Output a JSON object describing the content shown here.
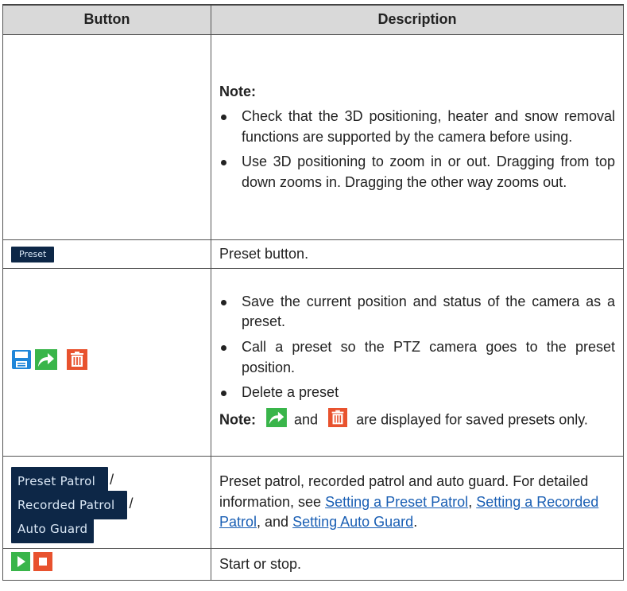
{
  "table": {
    "headers": [
      "Button",
      "Description"
    ],
    "row_note": {
      "note_label": "Note:",
      "bullets": [
        "Check that the 3D positioning, heater and snow removal functions are supported by the camera before using.",
        "Use 3D positioning to zoom in or out. Dragging from top down zooms in. Dragging the other way zooms out."
      ]
    },
    "row_preset": {
      "button_label": "Preset",
      "description": "Preset button."
    },
    "row_preset_actions": {
      "icons": [
        "save-icon",
        "call-preset-arrow-icon",
        "delete-trash-icon"
      ],
      "bullets": [
        "Save the current position and status of the camera as a preset.",
        "Call a preset so the PTZ camera goes to the preset position.",
        "Delete a preset"
      ],
      "note_label": "Note:",
      "note_and": "and",
      "note_tail": "are displayed for saved presets only."
    },
    "row_patrol": {
      "buttons": [
        "Preset Patrol",
        "Recorded Patrol",
        "Auto Guard"
      ],
      "separator": "/",
      "desc_prefix": "Preset patrol, recorded patrol and auto guard. For detailed information, see ",
      "link1": "Setting a Preset Patrol",
      "sep1": ",",
      "link2": "Setting a Recorded Patrol",
      "sep2": ", and ",
      "link3": "Setting Auto Guard",
      "end": "."
    },
    "row_startstop": {
      "icons": [
        "play-icon",
        "stop-icon"
      ],
      "description": "Start or stop."
    }
  },
  "colors": {
    "header_bg": "#d9d9d9",
    "ui_button_bg": "#0d2747",
    "save_icon": "#1f86d9",
    "call_icon": "#39b54a",
    "delete_icon": "#e8522e",
    "link": "#1a5fb4"
  }
}
